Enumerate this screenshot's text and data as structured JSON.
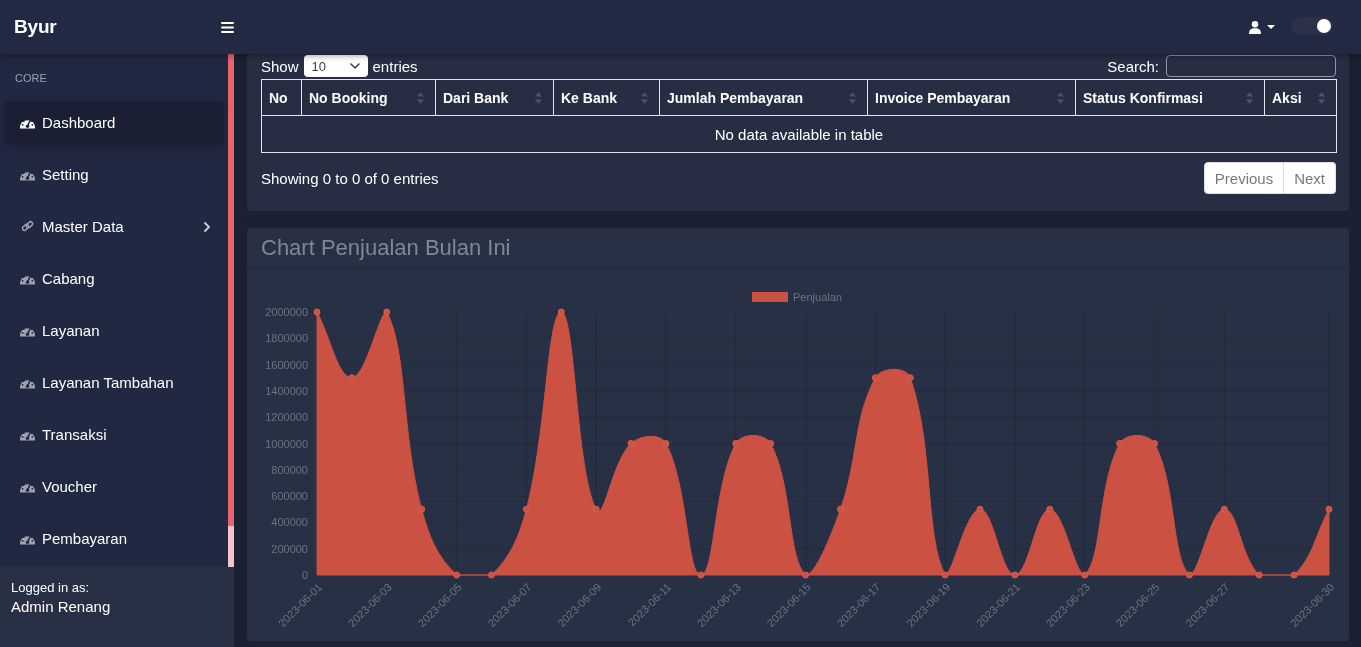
{
  "navbar": {
    "brand": "Byur",
    "theme_toggle": {
      "on": true
    }
  },
  "sidebar": {
    "heading": "CORE",
    "items": [
      {
        "label": "Dashboard",
        "kind": "link",
        "selected": true
      },
      {
        "label": "Setting",
        "kind": "link",
        "selected": false
      },
      {
        "label": "Master Data",
        "kind": "group",
        "selected": false
      },
      {
        "label": "Cabang",
        "kind": "link",
        "selected": false
      },
      {
        "label": "Layanan",
        "kind": "link",
        "selected": false
      },
      {
        "label": "Layanan Tambahan",
        "kind": "link",
        "selected": false
      },
      {
        "label": "Transaksi",
        "kind": "link",
        "selected": false
      },
      {
        "label": "Voucher",
        "kind": "link",
        "selected": false
      },
      {
        "label": "Pembayaran",
        "kind": "link",
        "selected": false
      }
    ],
    "footer": {
      "caption": "Logged in as:",
      "user": "Admin Renang"
    }
  },
  "table_card": {
    "length_prefix": "Show",
    "page_length": "10",
    "length_suffix": "entries",
    "search_label": "Search:",
    "columns": [
      {
        "label": "No",
        "sortable": false
      },
      {
        "label": "No Booking",
        "sortable": true
      },
      {
        "label": "Dari Bank",
        "sortable": true
      },
      {
        "label": "Ke Bank",
        "sortable": true
      },
      {
        "label": "Jumlah Pembayaran",
        "sortable": true
      },
      {
        "label": "Invoice Pembayaran",
        "sortable": true
      },
      {
        "label": "Status Konfirmasi",
        "sortable": true
      },
      {
        "label": "Aksi",
        "sortable": true
      }
    ],
    "empty_message": "No data available in table",
    "info": "Showing 0 to 0 of 0 entries",
    "pagination": [
      {
        "label": "Previous",
        "disabled": true
      },
      {
        "label": "Next",
        "disabled": true
      }
    ]
  },
  "chart_card": {
    "title": "Chart Penjualan Bulan Ini",
    "chart_data": {
      "type": "area",
      "grid": true,
      "categories": [
        "2023-06-01",
        null,
        "2023-06-03",
        null,
        "2023-06-05",
        null,
        "2023-06-07",
        null,
        "2023-06-09",
        null,
        "2023-06-11",
        null,
        "2023-06-13",
        null,
        "2023-06-15",
        null,
        "2023-06-17",
        null,
        "2023-06-19",
        null,
        "2023-06-21",
        null,
        "2023-06-23",
        null,
        "2023-06-25",
        null,
        "2023-06-27",
        null,
        null,
        "2023-06-30"
      ],
      "ylim": [
        0,
        2000000
      ],
      "yticks": [
        0,
        200000,
        400000,
        600000,
        800000,
        1000000,
        1200000,
        1400000,
        1600000,
        1800000,
        2000000
      ],
      "series": [
        {
          "name": "Penjualan",
          "color": "#cb5143",
          "values": [
            2000000,
            1500000,
            2000000,
            500000,
            0,
            0,
            500000,
            2000000,
            500000,
            1000000,
            1000000,
            0,
            1000000,
            1000000,
            0,
            500000,
            1500000,
            1500000,
            0,
            500000,
            0,
            500000,
            0,
            1000000,
            1000000,
            0,
            500000,
            0,
            0,
            500000
          ]
        }
      ]
    }
  }
}
